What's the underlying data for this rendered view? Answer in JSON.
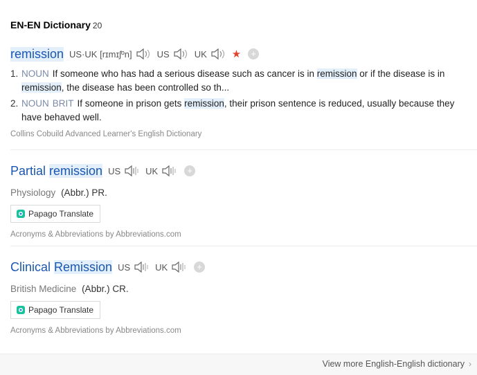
{
  "header": {
    "title": "EN-EN Dictionary",
    "count": "20"
  },
  "entry1": {
    "word": "remission",
    "pron_label": "US·UK",
    "pron_text": "[rɪmɪʃºn]",
    "us_label": "US",
    "uk_label": "UK",
    "defs": [
      {
        "num": "1.",
        "pos": "NOUN",
        "pre": "If someone who has had a serious disease such as cancer is in",
        "hl1": "remission",
        "mid": "or if the disease is in",
        "hl2": "remission",
        "post": ", the disease has been controlled so th..."
      },
      {
        "num": "2.",
        "pos": "NOUN",
        "pos2": "BRIT",
        "pre": "If someone in prison gets",
        "hl1": "remission",
        "post": ", their prison sentence is reduced, usually because they have behaved well."
      }
    ],
    "source": "Collins Cobuild Advanced Learner's English Dictionary"
  },
  "entry2": {
    "word_pre": "Partial",
    "word_hl": "remission",
    "us_label": "US",
    "uk_label": "UK",
    "field": "Physiology",
    "abbr": "(Abbr.) PR.",
    "papago": "Papago Translate",
    "source": "Acronyms & Abbreviations by Abbreviations.com"
  },
  "entry3": {
    "word_pre": "Clinical",
    "word_hl": "Remission",
    "us_label": "US",
    "uk_label": "UK",
    "field": "British Medicine",
    "abbr": "(Abbr.) CR.",
    "papago": "Papago Translate",
    "source": "Acronyms & Abbreviations by Abbreviations.com"
  },
  "footer": {
    "more": "View more English-English dictionary"
  },
  "colors": {
    "link": "#1b56b0",
    "highlight": "#e3f0fb",
    "star": "#e0452e"
  }
}
